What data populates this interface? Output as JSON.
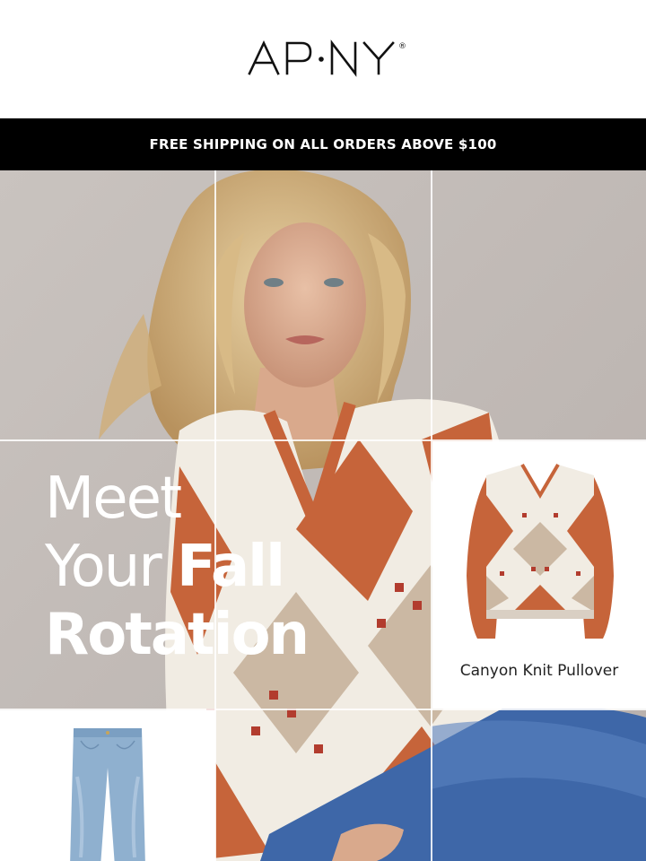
{
  "brand": {
    "logo_text": "AP·NY",
    "trademark": "®"
  },
  "banner": {
    "text": "FREE SHIPPING ON ALL ORDERS ABOVE $100",
    "background": "#000000"
  },
  "hero": {
    "headline": {
      "line1": "Meet",
      "line2_light": "Your ",
      "line2_bold": "Fall",
      "line3": "Rotation"
    }
  },
  "products": [
    {
      "name": "Canyon Knit Pullover",
      "icon": "pullover-product-image"
    },
    {
      "name": "",
      "icon": "jeans-product-image"
    }
  ],
  "colors": {
    "rust": "#c6643a",
    "cream": "#f3eee6",
    "taupe": "#cbb8a3",
    "denim": "#8fb0cf"
  }
}
